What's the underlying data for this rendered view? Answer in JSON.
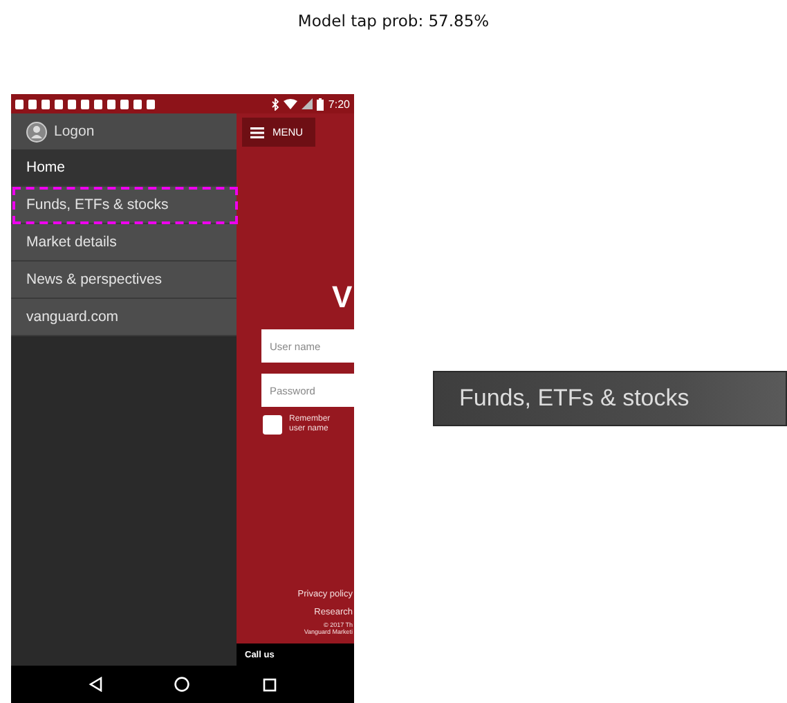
{
  "caption": "Model tap prob: 57.85%",
  "phone": {
    "status_bar": {
      "time": "7:20"
    },
    "drawer": {
      "account": "Logon",
      "items": [
        {
          "label": "Home",
          "selected": true,
          "tap_target": false
        },
        {
          "label": "Funds, ETFs & stocks",
          "selected": false,
          "tap_target": true
        },
        {
          "label": "Market details",
          "selected": false,
          "tap_target": false
        },
        {
          "label": "News & perspectives",
          "selected": false,
          "tap_target": false
        },
        {
          "label": "vanguard.com",
          "selected": false,
          "tap_target": false
        }
      ]
    },
    "menu_button": "MENU",
    "logo": "V",
    "fields": [
      {
        "placeholder": "User name"
      },
      {
        "placeholder": "Password"
      }
    ],
    "remember": {
      "label": "Remember user name",
      "checked": false
    },
    "footer_links": [
      "Privacy policy",
      "Research"
    ],
    "copyright": [
      "© 2017 Th",
      "Vanguard Marketi"
    ],
    "call_bar": "Call us"
  },
  "zoom_panel": {
    "label": "Funds, ETFs & stocks"
  }
}
